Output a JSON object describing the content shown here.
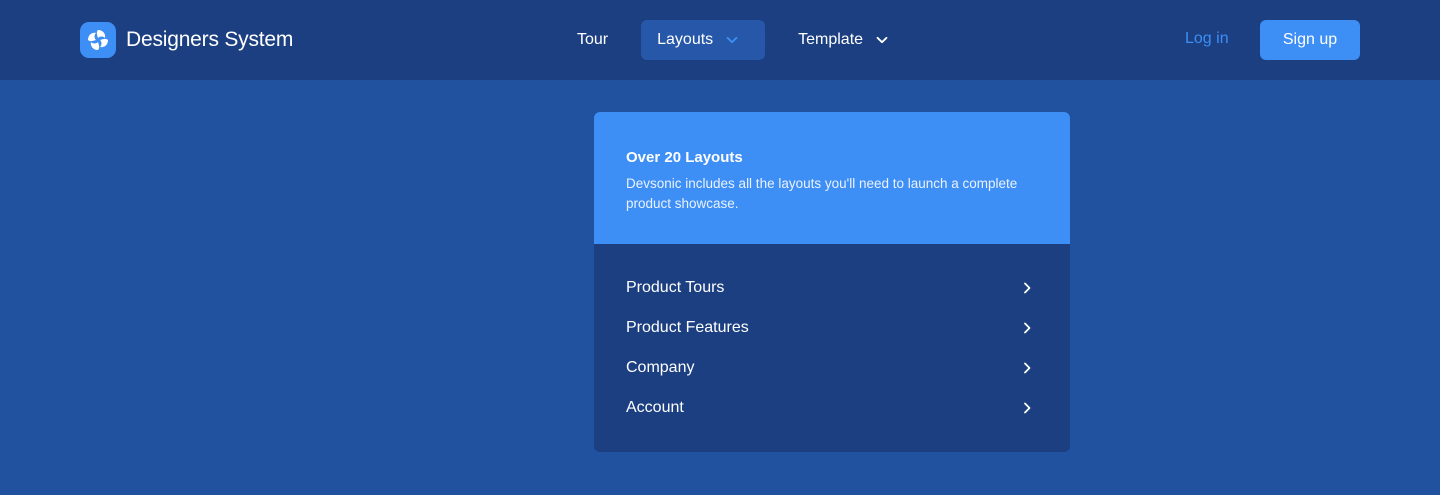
{
  "brand": {
    "name": "Designers System",
    "logo_icon": "swirl-logo-icon",
    "logo_color": "#3d8ef5"
  },
  "nav": {
    "items": [
      {
        "label": "Tour",
        "has_dropdown": false
      },
      {
        "label": "Layouts",
        "has_dropdown": true,
        "active": true
      },
      {
        "label": "Template",
        "has_dropdown": true
      }
    ]
  },
  "auth": {
    "login_label": "Log in",
    "signup_label": "Sign up"
  },
  "dropdown": {
    "title": "Over 20 Layouts",
    "description": "Devsonic includes all the layouts you'll need to launch a complete product showcase.",
    "items": [
      {
        "label": "Product Tours"
      },
      {
        "label": "Product Features"
      },
      {
        "label": "Company"
      },
      {
        "label": "Account"
      }
    ]
  },
  "colors": {
    "page_background": "#2152a0",
    "navbar_background": "#1b3f80",
    "accent": "#3d8ef5",
    "active_nav_background": "#2657a8",
    "dropdown_body": "#1b3f80",
    "text": "#ffffff"
  }
}
